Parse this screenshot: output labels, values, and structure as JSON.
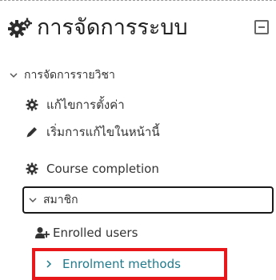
{
  "block": {
    "title": "การจัดการระบบ",
    "icon": "cogs-icon",
    "collapse_icon": "minus-square-icon"
  },
  "tree": {
    "course_admin": {
      "label": "การจัดการรายวิชา",
      "icon": "chevron-down-icon"
    },
    "items": [
      {
        "label": "แก้ไขการตั้งค่า",
        "icon": "cog-icon"
      },
      {
        "label": "เริ่มการแก้ไขในหน้านี้",
        "icon": "pencil-icon"
      },
      {
        "label": "Course completion",
        "icon": "cog-icon"
      }
    ],
    "members": {
      "label": "สมาชิก",
      "icon": "chevron-down-icon",
      "children": [
        {
          "label": "Enrolled users",
          "icon": "user-plus-icon"
        },
        {
          "label": "Enrolment methods",
          "icon": "chevron-right-icon"
        }
      ]
    }
  },
  "colors": {
    "link": "#1f7a8c",
    "highlight": "#e8171a"
  }
}
